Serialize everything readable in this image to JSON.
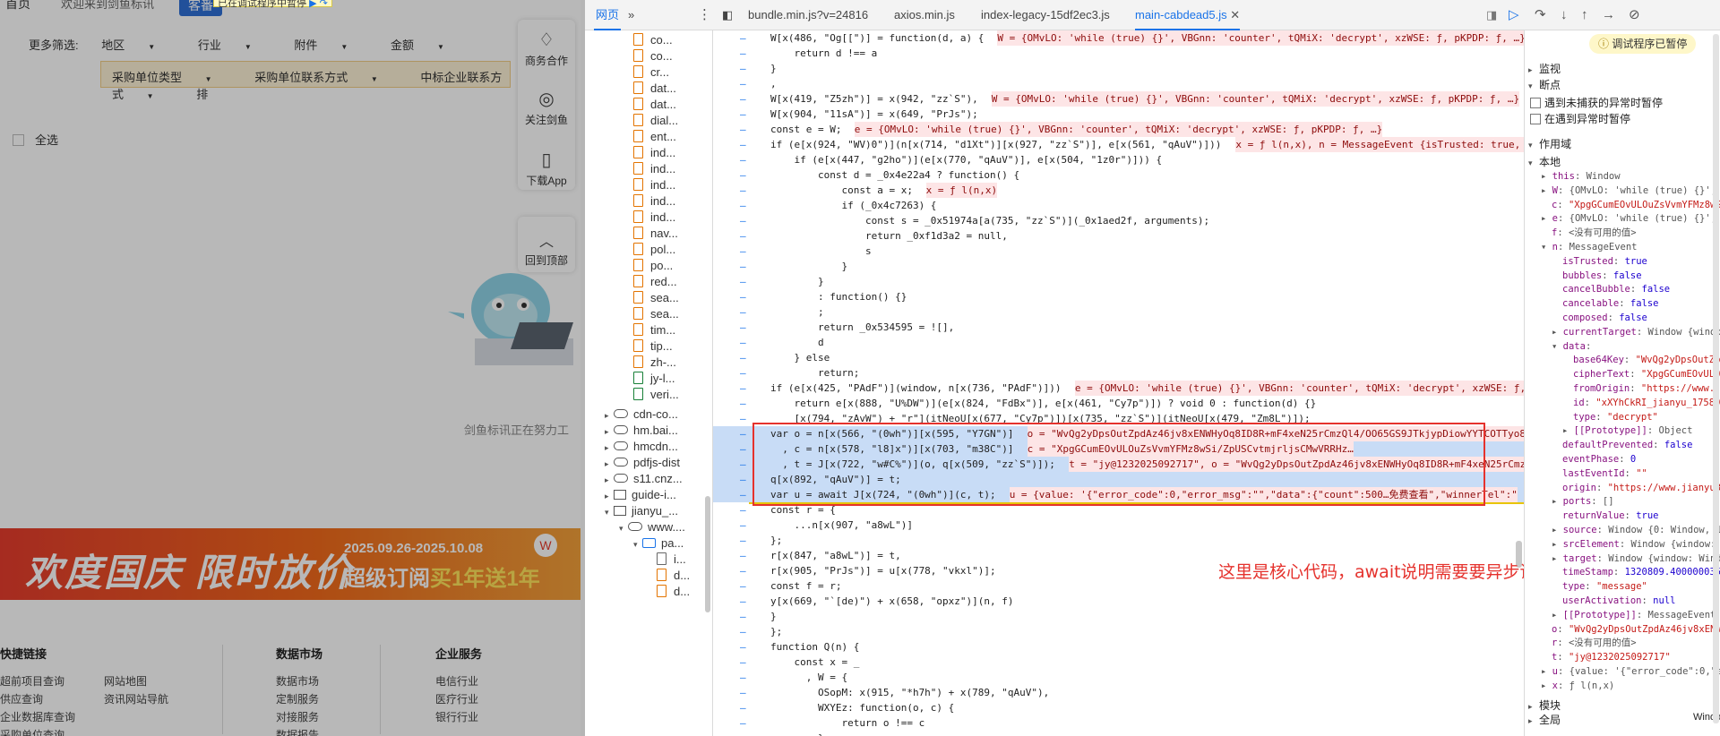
{
  "website": {
    "topbar": {
      "home": "首页",
      "welcome": "欢迎来到剑鱼标讯",
      "tender": "客番",
      "paused_overlay": "已在调试程序中暂停",
      "resume_icon": "resume-icon",
      "step_icon": "step-icon"
    },
    "filters": {
      "label": "更多筛选:",
      "items": [
        "地区",
        "行业",
        "附件",
        "金额"
      ],
      "bar2": [
        "采购单位类型",
        "采购单位联系方式",
        "中标企业联系方式",
        "排"
      ]
    },
    "select_all": "全选",
    "float_menu": [
      "商务合作",
      "关注剑鱼",
      "下载App",
      "回到顶部"
    ],
    "loading": "剑鱼标讯正在努力工",
    "banner": {
      "title": "欢度国庆 限时放价",
      "dates": "2025.09.26-2025.10.08",
      "slogan_a": "超级订阅",
      "slogan_b": "买1年送1年"
    },
    "footer": {
      "col1": {
        "title": "快捷链接",
        "links": [
          "超前项目查询",
          "供应查询",
          "企业数据库查询",
          "采购单位查询"
        ]
      },
      "col1b": {
        "links": [
          "网站地图",
          "资讯网站导航"
        ]
      },
      "col2": {
        "title": "数据市场",
        "links": [
          "数据市场",
          "定制服务",
          "对接服务",
          "数据报告"
        ]
      },
      "col3": {
        "title": "企业服务",
        "links": [
          "电信行业",
          "医疗行业",
          "银行行业"
        ]
      }
    }
  },
  "devtools": {
    "nav_tabs": [
      "网页",
      "»"
    ],
    "file_tabs": [
      "bundle.min.js?v=24816",
      "axios.min.js",
      "index-legacy-15df2ec3.js",
      "main-cabdead5.js"
    ],
    "active_file": "main-cabdead5.js",
    "tree": {
      "files": [
        "co...",
        "co...",
        "cr...",
        "dat...",
        "dat...",
        "dial...",
        "ent...",
        "ind...",
        "ind...",
        "ind...",
        "ind...",
        "ind...",
        "nav...",
        "pol...",
        "po...",
        "red...",
        "sea...",
        "sea...",
        "tim...",
        "tip...",
        "zh-...",
        "jy-l...",
        "veri..."
      ],
      "domains": [
        "cdn-co...",
        "hm.bai...",
        "hmcdn...",
        "pdfjs-dist",
        "s11.cnz...",
        "guide-i...",
        "jianyu_...",
        "www....",
        "pa...",
        "i...",
        "d...",
        "d..."
      ]
    },
    "code_lines": [
      "W[x(486, \"Og[[\")] = function(d, a) {",
      "    return d !== a",
      "}",
      ",",
      "W[x(419, \"Z5zh\")] = x(942, \"zz`S\"),",
      "W[x(904, \"11sA\")] = x(649, \"PrJs\");",
      "const e = W;",
      "if (e[x(924, \"WV)0\")](n[x(714, \"d1Xt\")][x(927, \"zz`S\")], e[x(561, \"qAuV\")]))",
      "    if (e[x(447, \"g2ho\")](e[x(770, \"qAuV\")], e[x(504, \"1z0r\")])) {",
      "        const d = _0x4e22a4 ? function() {",
      "            const a = x;",
      "            if (_0x4c7263) {",
      "                const s = _0x51974a[a(735, \"zz`S\")](_0x1aed2f, arguments);",
      "                return _0xf1d3a2 = null,",
      "                s",
      "            }",
      "        }",
      "        : function() {}",
      "        ;",
      "        return _0x534595 = ![],",
      "        d",
      "    } else",
      "        return;",
      "if (e[x(425, \"PAdF\")](window, n[x(736, \"PAdF\")]))",
      "    return e[x(888, \"U%DW\")](e[x(824, \"FdBx\")], e[x(461, \"Cy7p\")]) ? void 0 : function(d) {}",
      "    [x(794, \"zAvW\") + \"r\"](itNeoU[x(677, \"Cy7p\")])[x(735, \"zz`S\")](itNeoU[x(479, \"Zm8L\")]);",
      "var o = n[x(566, \"(0wh\")][x(595, \"Y7GN\")]",
      "  , c = n[x(578, \"l8]x\")][x(703, \"m38C\")]",
      "  , t = J[x(722, \"w#C%\")](o, q[x(509, \"zz`S\")]);",
      "q[x(892, \"qAuV\")] = t;",
      "var u = await J[x(724, \"(0wh\")](c, t);",
      "const r = {",
      "    ...n[x(907, \"a8wL\")]",
      "};",
      "r[x(847, \"a8wL\")] = t,",
      "r[x(905, \"PrJs\")] = u[x(778, \"vkxl\")];",
      "const f = r;",
      "y[x(669, \"`[de)\") + x(658, \"opxz\")](n, f)",
      "}",
      "};",
      "function Q(n) {",
      "    const x = _",
      "      , W = {",
      "        OSopM: x(915, \"*h7h\") + x(789, \"qAuV\"),",
      "        WXYEz: function(o, c) {",
      "            return o !== c",
      "        },"
    ],
    "inline_values": [
      {
        "line": 0,
        "text": "W = {OMvLO: 'while (true) {}', VBGnn: 'counter', tQMiX: 'decrypt', xzWSE: ƒ, pKPDP: ƒ, …}"
      },
      {
        "line": 4,
        "text": "W = {OMvLO: 'while (true) {}', VBGnn: 'counter', tQMiX: 'decrypt', xzWSE: ƒ, pKPDP: ƒ, …}"
      },
      {
        "line": 6,
        "text": "e = {OMvLO: 'while (true) {}', VBGnn: 'counter', tQMiX: 'decrypt', xzWSE: ƒ, pKPDP: ƒ, …}"
      },
      {
        "line": 7,
        "text": "x = ƒ l(n,x), n = MessageEvent {isTrusted: true, d"
      },
      {
        "line": 10,
        "text": "x = ƒ l(n,x)"
      },
      {
        "line": 23,
        "text": "e = {OMvLO: 'while (true) {}', VBGnn: 'counter', tQMiX: 'decrypt', xzWSE: ƒ, p"
      },
      {
        "line": 26,
        "text": "o = \"WvQg2yDpsOutZpdAz46jv8xENWHyOq8ID8R+mF4xeN25rCmzQl4/OO65GS9JTkjypDiowYYTCOTTyo8kl"
      },
      {
        "line": 27,
        "text": "c = \"XpgGCumEOvULOuZsVvmYFMz8wSi/ZpUSCvtmjrljsCMwVRRHz…"
      },
      {
        "line": 28,
        "text": "t = \"jy@1232025092717\", o = \"WvQg2yDpsOutZpdAz46jv8xENWHyOq8ID8R+mF4xeN25rCmzQl"
      },
      {
        "line": 30,
        "text": "u = {value: '{\"error_code\":0,\"error_msg\":\"\",\"data\":{\"count\":500…免费查看\",\"winnerTel\":\""
      }
    ],
    "annotation": "这里是核心代码，await说明需要要异步调用",
    "debugger": {
      "paused": "调试程序已暂停",
      "sections": [
        "监视",
        "断点"
      ],
      "checkboxes": [
        "遇到未捕获的异常时暂停",
        "在遇到异常时暂停"
      ],
      "scope": "作用域",
      "local": "本地",
      "modules": "模块",
      "global": "全局",
      "global_val": "Window",
      "vars": [
        {
          "k": "this",
          "v": "Window"
        },
        {
          "k": "W",
          "v": "{OMvLO: 'while (true) {}', VBGn"
        },
        {
          "k": "c",
          "v": "\"XpgGCumEOvULOuZsVvmYFMz8wSi/Zp"
        },
        {
          "k": "e",
          "v": "{OMvLO: 'while (true) {}', VBGn"
        },
        {
          "k": "f",
          "v": "<没有可用的值>"
        },
        {
          "k": "n",
          "v": "MessageEvent"
        },
        {
          "k": "isTrusted",
          "v": "true"
        },
        {
          "k": "bubbles",
          "v": "false"
        },
        {
          "k": "cancelBubble",
          "v": "false"
        },
        {
          "k": "cancelable",
          "v": "false"
        },
        {
          "k": "composed",
          "v": "false"
        },
        {
          "k": "currentTarget",
          "v": "Window {window: W"
        },
        {
          "k": "data",
          "v": ""
        },
        {
          "k": "base64Key",
          "v": "\"WvQg2yDpsOutZpdAz"
        },
        {
          "k": "cipherText",
          "v": "\"XpgGCumEOvULOuZs"
        },
        {
          "k": "fromOrigin",
          "v": "\"https://www.jia"
        },
        {
          "k": "id",
          "v": "\"xXYhCkRI_jianyu_175896344"
        },
        {
          "k": "type",
          "v": "\"decrypt\""
        },
        {
          "k": "[[Prototype]]",
          "v": "Object"
        },
        {
          "k": "defaultPrevented",
          "v": "false"
        },
        {
          "k": "eventPhase",
          "v": "0"
        },
        {
          "k": "lastEventId",
          "v": "\"\""
        },
        {
          "k": "origin",
          "v": "\"https://www.jianyu360.c"
        },
        {
          "k": "ports",
          "v": "[]"
        },
        {
          "k": "returnValue",
          "v": "true"
        },
        {
          "k": "source",
          "v": "Window {0: Window, 1: W"
        },
        {
          "k": "srcElement",
          "v": "Window {window: Win"
        },
        {
          "k": "target",
          "v": "Window {window: Window,"
        },
        {
          "k": "timeStamp",
          "v": "1320809.4000000358"
        },
        {
          "k": "type",
          "v": "\"message\""
        },
        {
          "k": "userActivation",
          "v": "null"
        },
        {
          "k": "[[Prototype]]",
          "v": "MessageEvent"
        },
        {
          "k": "o",
          "v": "\"WvQg2yDpsOutZpdAz46jv8xENWHyOq"
        },
        {
          "k": "r",
          "v": "<没有可用的值>"
        },
        {
          "k": "t",
          "v": "\"jy@1232025092717\""
        },
        {
          "k": "u",
          "v": "{value: '{\"error_code\":0,\"error"
        },
        {
          "k": "x",
          "v": "ƒ l(n,x)"
        }
      ]
    }
  }
}
